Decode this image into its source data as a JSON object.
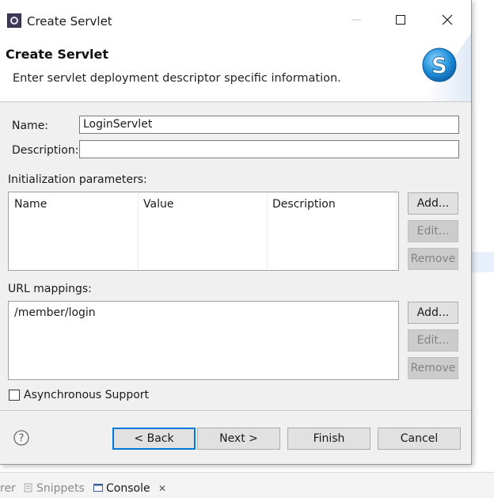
{
  "window": {
    "title": "Create Servlet",
    "controls": {
      "minimize": "minimize-icon",
      "maximize": "maximize-icon",
      "close": "close-icon"
    }
  },
  "header": {
    "title": "Create Servlet",
    "description": "Enter servlet deployment descriptor specific information.",
    "banner_icon": "servlet-s-icon"
  },
  "form": {
    "name_label": "Name:",
    "name_value": "LoginServlet",
    "description_label": "Description:",
    "description_value": ""
  },
  "init_params": {
    "label": "Initialization parameters:",
    "columns": [
      "Name",
      "Value",
      "Description"
    ],
    "rows": [],
    "buttons": {
      "add": "Add...",
      "edit": "Edit...",
      "remove": "Remove"
    }
  },
  "url_mappings": {
    "label": "URL mappings:",
    "items": [
      "/member/login"
    ],
    "buttons": {
      "add": "Add...",
      "edit": "Edit...",
      "remove": "Remove"
    }
  },
  "async": {
    "label": "Asynchronous Support",
    "checked": false
  },
  "footer": {
    "help_icon": "help-icon",
    "back": "< Back",
    "next": "Next >",
    "finish": "Finish",
    "cancel": "Cancel"
  },
  "background_tabs": [
    "rer",
    "Snippets",
    "Console"
  ],
  "colors": {
    "accent": "#0078d7",
    "disabled_bg": "#cccccc",
    "dialog_bg": "#f0f0f0"
  }
}
